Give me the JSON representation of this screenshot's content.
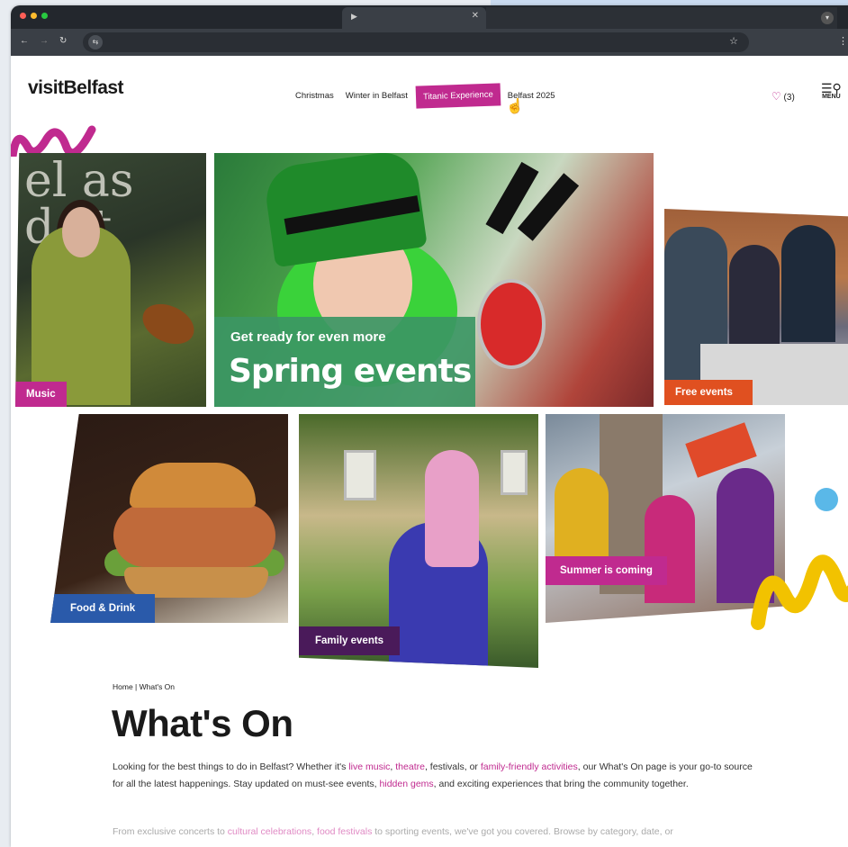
{
  "browser": {
    "tab_title": "",
    "dots": [
      "#ff5f57",
      "#febc2e",
      "#28c840"
    ]
  },
  "site": {
    "logo": "visitBelfast",
    "nav": {
      "christmas": "Christmas",
      "winter": "Winter in Belfast",
      "titanic": "Titanic Experience",
      "belfast2025": "Belfast 2025"
    },
    "favourites": "(3)",
    "menu_label": "MENU"
  },
  "tiles": {
    "music": "Music",
    "spring_small": "Get ready for even more",
    "spring_big": "Spring events",
    "music_banner": "el ast\nd st",
    "free": "Free events",
    "food": "Food & Drink",
    "family": "Family events",
    "summer": "Summer is coming"
  },
  "content": {
    "breadcrumb": "Home | What's On",
    "title": "What's On",
    "p1": {
      "t1": "Looking for the best things to do in Belfast? Whether it's ",
      "l1": "live music",
      "t2": ", ",
      "l2": "theatre",
      "t3": ", festivals, or ",
      "l3": "family-friendly activities",
      "t4": ", our What's On page is your go-to source for all the latest happenings. Stay updated on must-see events, ",
      "l4": "hidden gems",
      "t5": ", and exciting experiences that bring the community together."
    },
    "p2": {
      "t1": "From exclusive concerts to ",
      "l1": "cultural celebrations",
      "t2": ", ",
      "l2": "food festivals",
      "t3": " to sporting events, we've got you covered. Browse by category, date, or"
    }
  },
  "colors": {
    "accent_magenta": "#c02a8f",
    "free_orange": "#e05020",
    "food_blue": "#2a5aaa",
    "family_purple": "#4a1a5a",
    "spring_green": "#3c9664",
    "yellow_brand": "#f2c200"
  }
}
